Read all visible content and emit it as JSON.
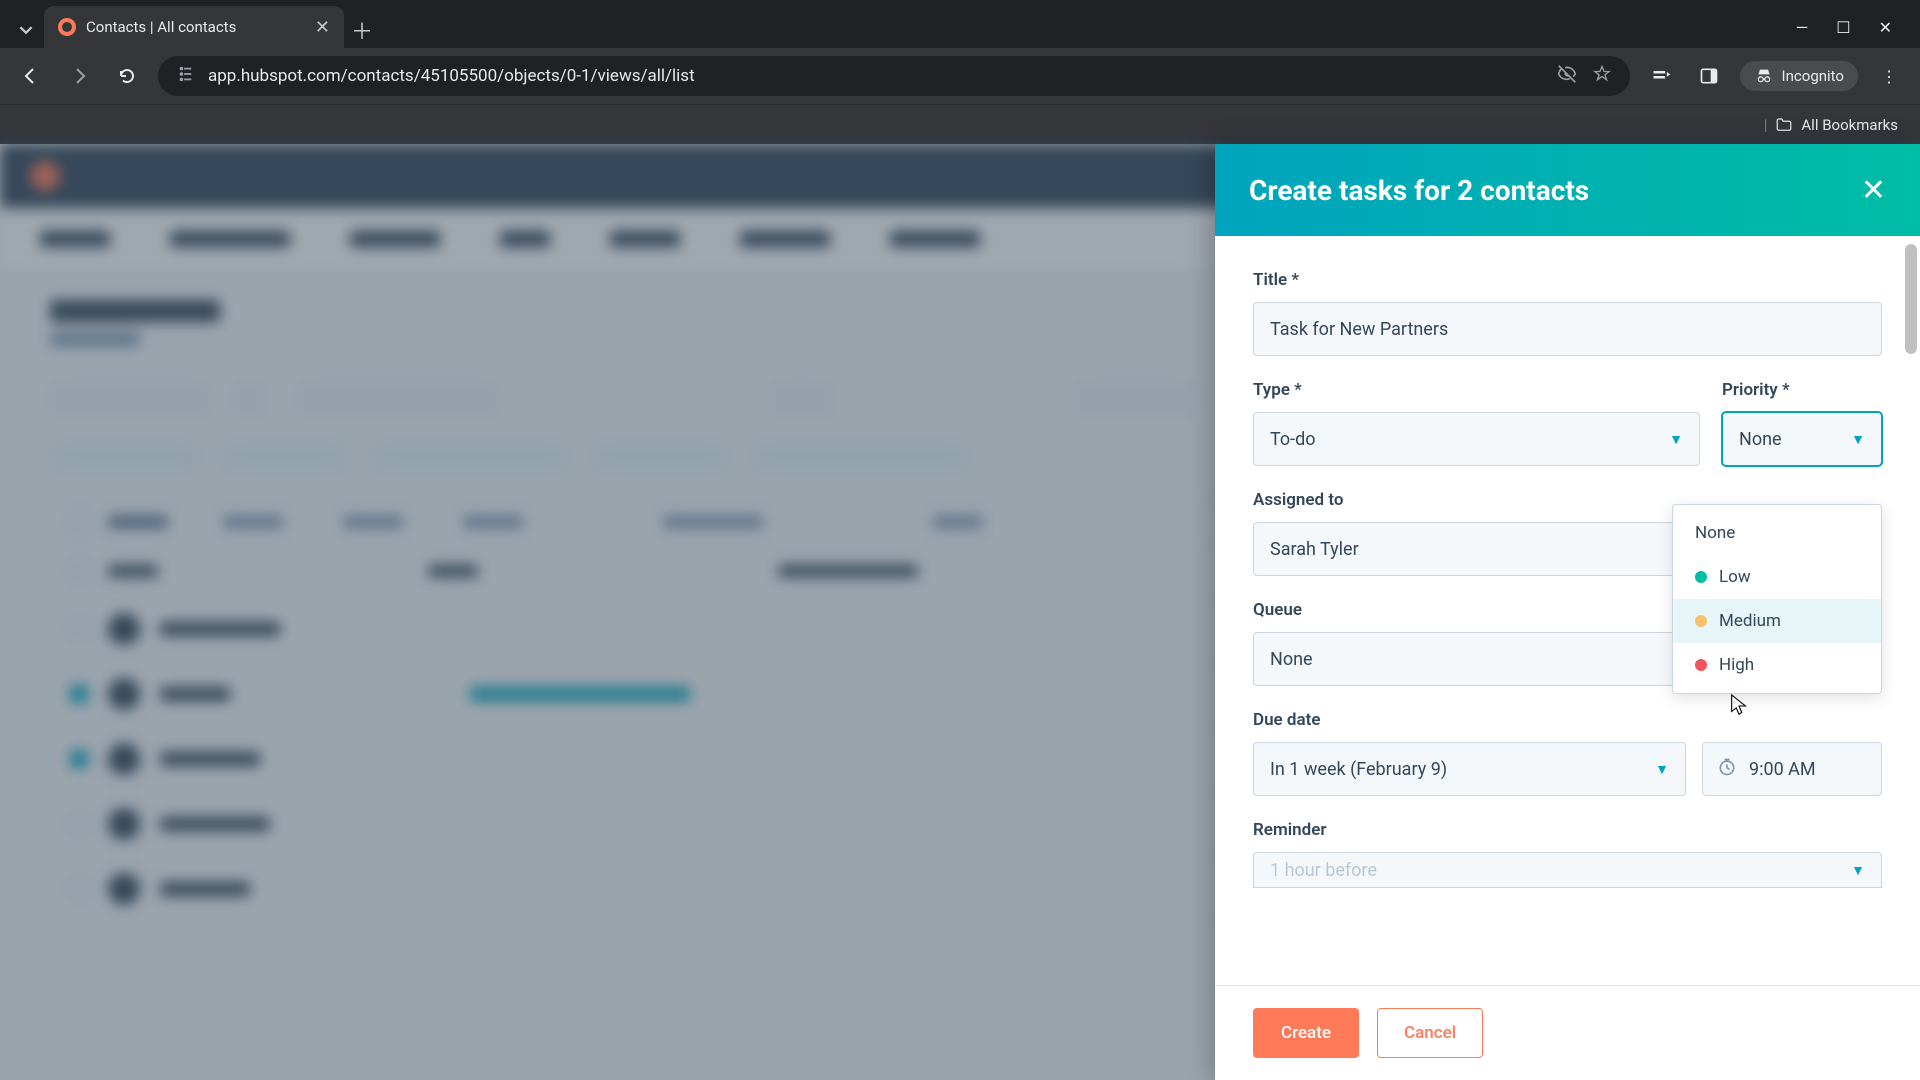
{
  "browser": {
    "tab_title": "Contacts | All contacts",
    "url": "app.hubspot.com/contacts/45105500/objects/0-1/views/all/list",
    "incognito_label": "Incognito",
    "bookmarks_label": "All Bookmarks"
  },
  "panel": {
    "title": "Create tasks for 2 contacts",
    "labels": {
      "title": "Title *",
      "type": "Type *",
      "priority": "Priority *",
      "assigned_to": "Assigned to",
      "queue": "Queue",
      "due_date": "Due date",
      "reminder": "Reminder"
    },
    "values": {
      "title": "Task for New Partners",
      "type": "To-do",
      "priority": "None",
      "assigned_to": "Sarah Tyler",
      "queue": "None",
      "due_date": "In 1 week (February 9)",
      "due_time": "9:00 AM",
      "reminder": "1 hour before"
    },
    "priority_options": {
      "none": "None",
      "low": "Low",
      "medium": "Medium",
      "high": "High"
    },
    "buttons": {
      "create": "Create",
      "cancel": "Cancel"
    }
  }
}
